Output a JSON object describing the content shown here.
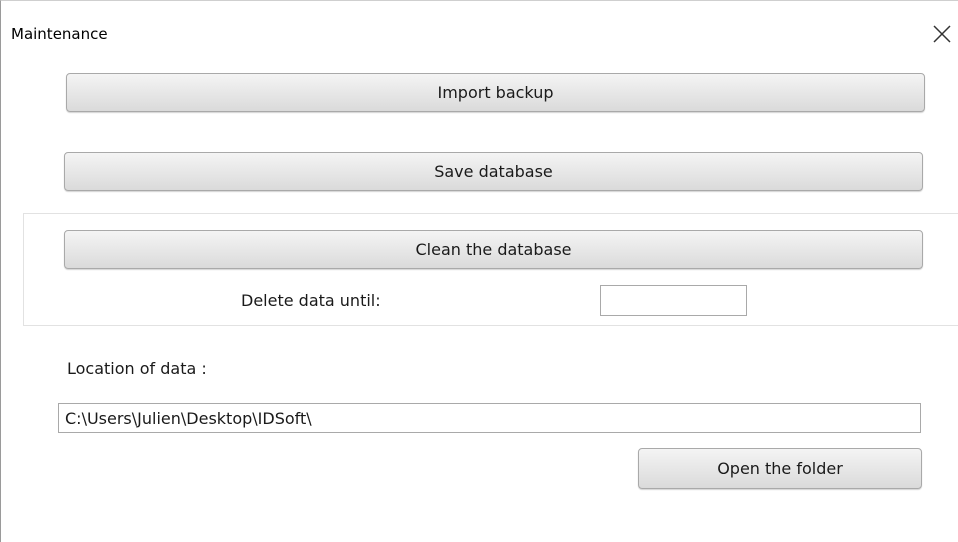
{
  "window": {
    "title": "Maintenance",
    "close_icon": "close-icon"
  },
  "actions": {
    "import_label": "Import backup",
    "save_label": "Save database",
    "clean_label": "Clean the database",
    "open_folder_label": "Open the folder"
  },
  "clean": {
    "delete_until_label": "Delete data until:",
    "delete_until_value": ""
  },
  "location": {
    "label": "Location of data :",
    "path": "C:\\Users\\Julien\\Desktop\\IDSoft\\"
  }
}
